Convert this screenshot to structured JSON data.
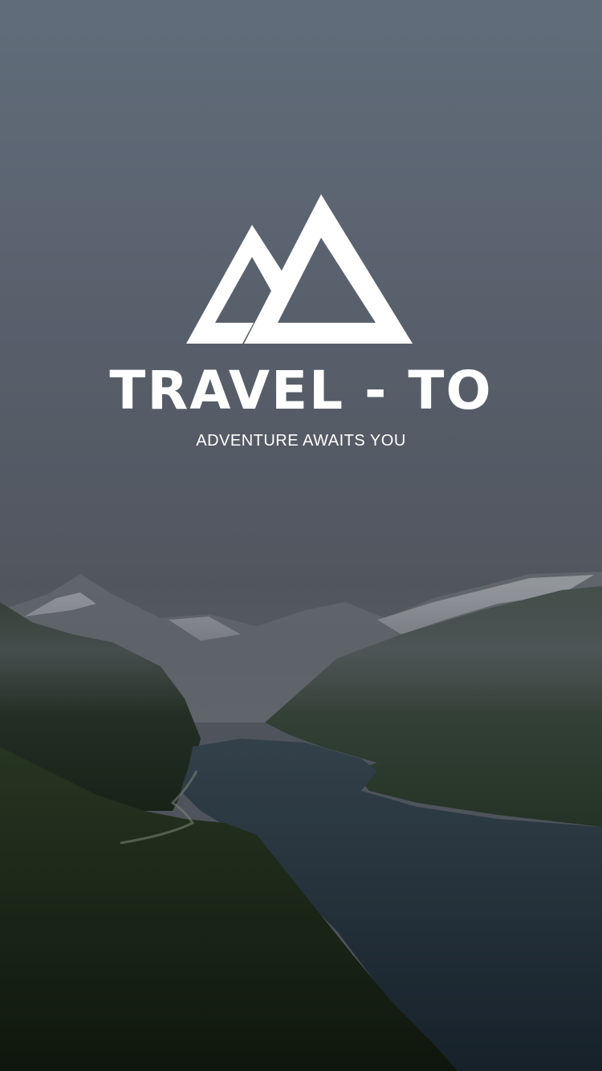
{
  "splash": {
    "logo_icon": "mountain-peaks-icon",
    "app_name": "TRAVEL - TO",
    "tagline": "ADVENTURE AWAITS YOU"
  },
  "colors": {
    "sky_top": "#6f7c8c",
    "sky_haze": "#5c6470",
    "fjord_water": "#24343f",
    "forest": "#1c2a1a",
    "text": "#ffffff"
  }
}
